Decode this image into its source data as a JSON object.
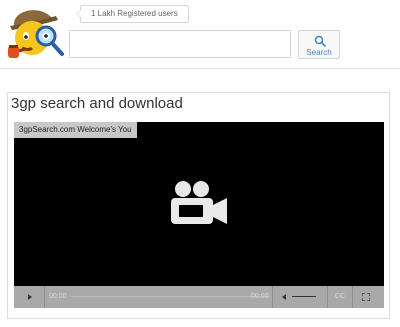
{
  "header": {
    "logo_icon": "detective-smiley-logo",
    "tagline": "1 Lakh Registered users",
    "search": {
      "value": "",
      "placeholder": ""
    },
    "search_button": {
      "icon": "search-icon",
      "label": "Search"
    }
  },
  "main": {
    "title": "3gp search and download",
    "player": {
      "badge": "3gpSearch.com Welcome's You",
      "center_icon": "video-camera-icon",
      "current_time": "00:00",
      "duration": "00:00",
      "cc_label": "CC",
      "controls": [
        "play-icon",
        "volume-icon",
        "fullscreen-icon"
      ]
    }
  },
  "colors": {
    "accent": "#3f86c9",
    "player_bg": "#000000",
    "controls_bg": "#a9a9a9",
    "badge_bg": "#c8c8c8"
  }
}
